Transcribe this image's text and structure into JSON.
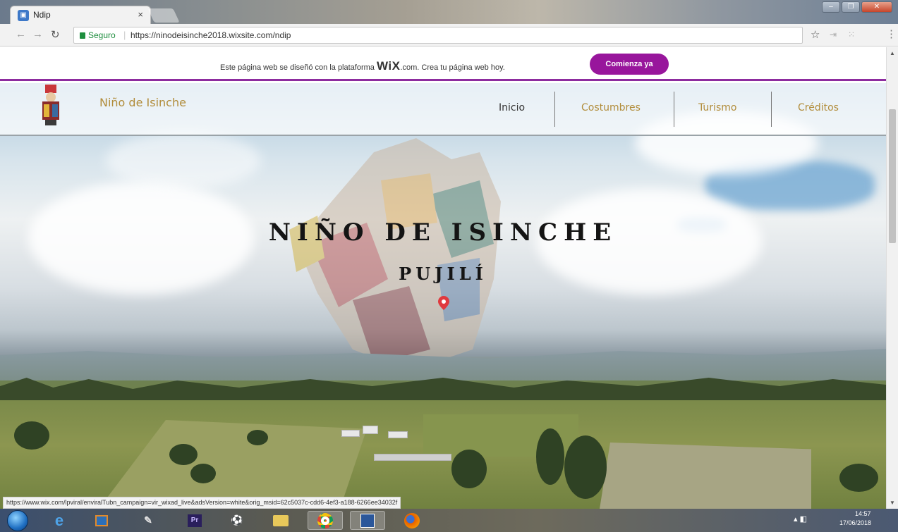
{
  "browser": {
    "tab_title": "Ndip",
    "tab_close": "×",
    "secure_label": "Seguro",
    "url": "https://ninodeisinche2018.wixsite.com/ndip",
    "status_url": "https://www.wix.com/lpviral/enviralTubn_campaign=vir_wixad_live&adsVersion=white&orig_msid=62c5037c-cdd6-4ef3-a188-6266ee34032f"
  },
  "wix_banner": {
    "text_before": "Este página web se diseñó con la plataforma ",
    "brand": "WiX",
    "text_after": ".com. Crea tu página web hoy.",
    "cta": "Comienza ya",
    "accent_color": "#98169c"
  },
  "site": {
    "name": "Niño de Isinche",
    "nav": [
      {
        "label": "Inicio",
        "color": "#333333"
      },
      {
        "label": "Costumbres",
        "color": "#b18c3a"
      },
      {
        "label": "Turismo",
        "color": "#b18c3a"
      },
      {
        "label": "Créditos",
        "color": "#b18c3a"
      }
    ]
  },
  "hero": {
    "title": "NIÑO DE ISINCHE",
    "subtitle": "PUJILÍ",
    "pin_icon": "map-pin-icon"
  },
  "taskbar": {
    "apps": [
      "start-orb",
      "ie-icon",
      "media-player-icon",
      "paint-icon",
      "premiere-icon",
      "soccer-icon",
      "file-explorer-icon",
      "chrome-icon",
      "word-icon",
      "firefox-icon"
    ],
    "premiere_label": "Pr",
    "time": "14:57",
    "date": "17/06/2018"
  }
}
